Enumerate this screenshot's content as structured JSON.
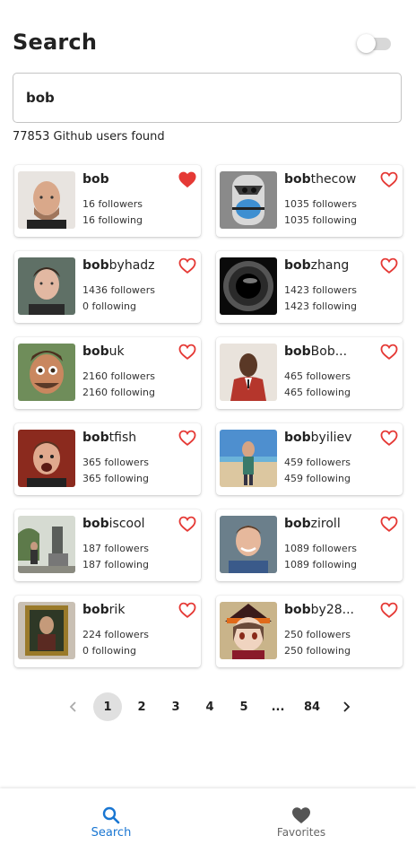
{
  "header": {
    "title": "Search"
  },
  "search": {
    "value": "bob",
    "results_text": "77853 Github users found"
  },
  "users": [
    {
      "bold": "bob",
      "rest": "",
      "followers": "16 followers",
      "following": "16 following",
      "favorited": true,
      "avatar": "bald-man"
    },
    {
      "bold": "bob",
      "rest": "thecow",
      "followers": "1035 followers",
      "following": "1035 following",
      "favorited": false,
      "avatar": "masked-character"
    },
    {
      "bold": "bob",
      "rest": "byhadz",
      "followers": "1436 followers",
      "following": "0 following",
      "favorited": false,
      "avatar": "young-man"
    },
    {
      "bold": "bob",
      "rest": "zhang",
      "followers": "1423 followers",
      "following": "1423 following",
      "favorited": false,
      "avatar": "black-hole"
    },
    {
      "bold": "bob",
      "rest": "uk",
      "followers": "2160 followers",
      "following": "2160 following",
      "favorited": false,
      "avatar": "cartoon-man"
    },
    {
      "bold": "bob",
      "rest": "Bob...",
      "followers": "465 followers",
      "following": "465 following",
      "favorited": false,
      "avatar": "suited-man"
    },
    {
      "bold": "bob",
      "rest": "tfish",
      "followers": "365 followers",
      "following": "365 following",
      "favorited": false,
      "avatar": "excited-man"
    },
    {
      "bold": "bob",
      "rest": "byiliev",
      "followers": "459 followers",
      "following": "459 following",
      "favorited": false,
      "avatar": "beach-man"
    },
    {
      "bold": "bob",
      "rest": "iscool",
      "followers": "187 followers",
      "following": "187 following",
      "favorited": false,
      "avatar": "statue-man"
    },
    {
      "bold": "bob",
      "rest": "ziroll",
      "followers": "1089 followers",
      "following": "1089 following",
      "favorited": false,
      "avatar": "smiling-man"
    },
    {
      "bold": "bob",
      "rest": "rik",
      "followers": "224 followers",
      "following": "0 following",
      "favorited": false,
      "avatar": "painting"
    },
    {
      "bold": "bob",
      "rest": "by28...",
      "followers": "250 followers",
      "following": "250 following",
      "favorited": false,
      "avatar": "anime-girl"
    }
  ],
  "pagination": {
    "pages": [
      "1",
      "2",
      "3",
      "4",
      "5",
      "...",
      "84"
    ],
    "current": "1"
  },
  "bottom_nav": {
    "search_label": "Search",
    "favorites_label": "Favorites"
  },
  "colors": {
    "heart": "#e53935",
    "accent": "#1976d2",
    "favorites_icon": "#555555"
  }
}
